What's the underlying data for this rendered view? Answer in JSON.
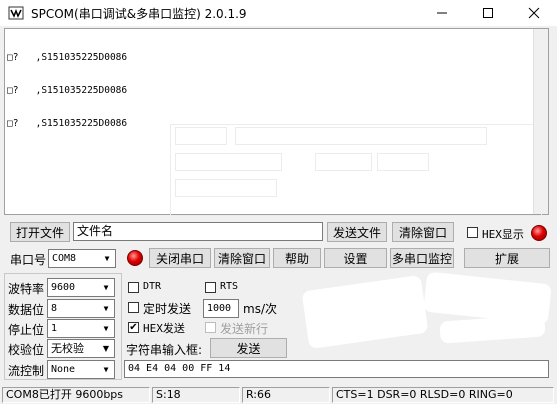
{
  "window": {
    "title": "SPCOM(串口调试&多串口监控)  2.0.1.9"
  },
  "receive": {
    "lines": [
      "□?   ,S151035225D0086",
      "□?   ,S151035225D0086",
      "□?   ,S151035225D0086"
    ]
  },
  "file_bar": {
    "open_file_label": "打开文件",
    "file_name_value": "文件名",
    "send_file_label": "发送文件",
    "clear_window_label": "清除窗口",
    "hex_display_label": "HEX显示",
    "hex_display_checked": false
  },
  "port_bar": {
    "port_label": "串口号",
    "port_value": "COM8",
    "close_port_label": "关闭串口",
    "clear_window_label": "清除窗口",
    "help_label": "帮助",
    "settings_label": "设置",
    "multi_port_label": "多串口监控",
    "expand_label": "扩展"
  },
  "serial_settings": {
    "baud_label": "波特率",
    "baud_value": "9600",
    "data_bits_label": "数据位",
    "data_bits_value": "8",
    "stop_bits_label": "停止位",
    "stop_bits_value": "1",
    "parity_label": "校验位",
    "parity_value": "无校验",
    "flow_label": "流控制",
    "flow_value": "None"
  },
  "send_options": {
    "dtr_label": "DTR",
    "dtr_checked": false,
    "rts_label": "RTS",
    "rts_checked": false,
    "timed_send_label": "定时发送",
    "timed_send_checked": false,
    "interval_value": "1000",
    "interval_unit": "ms/次",
    "hex_send_label": "HEX发送",
    "hex_send_checked": true,
    "send_newline_label": "发送新行",
    "send_newline_checked": false,
    "input_label": "字符串输入框:",
    "send_label": "发送",
    "send_value": "04 E4 04 00 FF 14"
  },
  "status_bar": {
    "port_status": "COM8已打开 9600bps",
    "sent": "S:18",
    "received": "R:66",
    "lines_status": "CTS=1 DSR=0 RLSD=0 RING=0"
  },
  "colors": {
    "led_red": "#e00000",
    "window_bg": "#f0f0f0",
    "button_bg": "#e1e1e1"
  }
}
